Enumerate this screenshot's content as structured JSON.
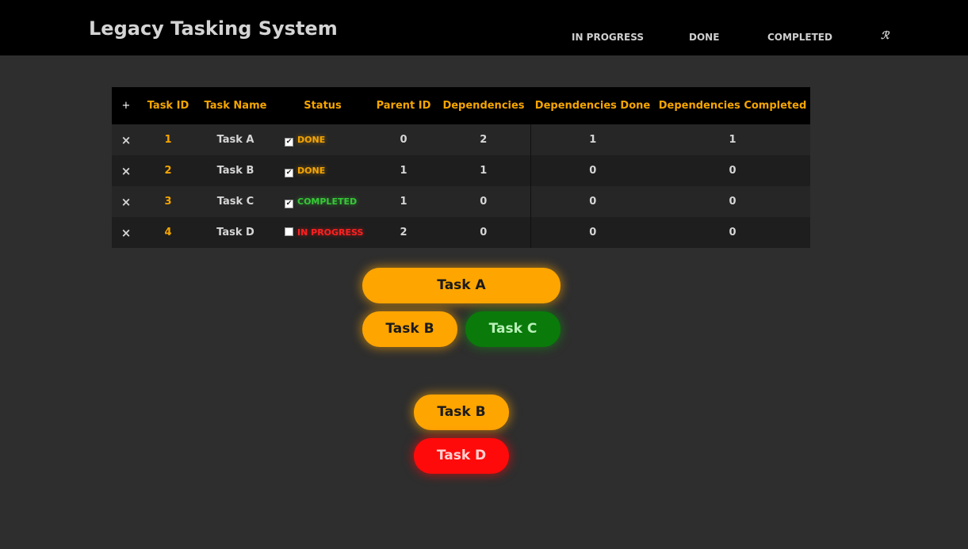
{
  "app": {
    "title": "Legacy Tasking System"
  },
  "nav": {
    "in_progress": "IN PROGRESS",
    "done": "DONE",
    "completed": "COMPLETED",
    "logo_glyph": "ℛ"
  },
  "table": {
    "add_glyph": "+",
    "headers": [
      "Task ID",
      "Task Name",
      "Status",
      "Parent ID",
      "Dependencies",
      "Dependencies Done",
      "Dependencies Completed"
    ],
    "remove_glyph": "×",
    "rows": [
      {
        "task_id": "1",
        "name": "Task A",
        "checked": true,
        "status": "DONE",
        "parent_id": "0",
        "dependencies": "2",
        "deps_done": "1",
        "deps_completed": "1"
      },
      {
        "task_id": "2",
        "name": "Task B",
        "checked": true,
        "status": "DONE",
        "parent_id": "1",
        "dependencies": "1",
        "deps_done": "0",
        "deps_completed": "0"
      },
      {
        "task_id": "3",
        "name": "Task C",
        "checked": true,
        "status": "COMPLETED",
        "parent_id": "1",
        "dependencies": "0",
        "deps_done": "0",
        "deps_completed": "0"
      },
      {
        "task_id": "4",
        "name": "Task D",
        "checked": false,
        "status": "IN PROGRESS",
        "parent_id": "2",
        "dependencies": "0",
        "deps_done": "0",
        "deps_completed": "0"
      }
    ]
  },
  "graph": {
    "tree1": {
      "root": "Task A",
      "child_left": "Task B",
      "child_right": "Task C"
    },
    "tree2": {
      "root": "Task B",
      "child": "Task D"
    }
  },
  "colors": {
    "accent": "#ffa500",
    "done": "#ffa500",
    "completed": "#0a7a0a",
    "in_progress": "#ff0a0a"
  }
}
